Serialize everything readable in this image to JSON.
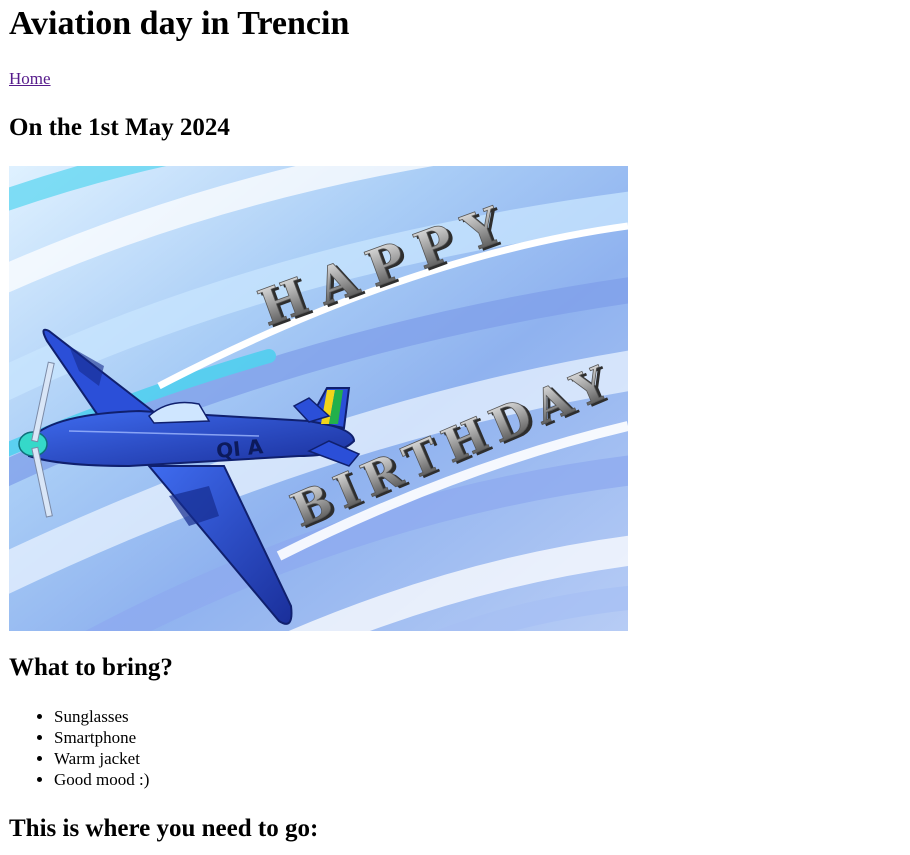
{
  "page_title": "Aviation day in Trencin",
  "nav": {
    "home_label": "Home"
  },
  "event_date": "On the 1st May 2024",
  "hero_image": {
    "line1": "HAPPY",
    "line2": "BIRTHDAY",
    "tail_code": "QI A",
    "colors": {
      "sky_light": "#eef6ff",
      "sky_mid": "#9fc4f5",
      "sky_deep": "#6f8fe6",
      "cyan": "#4fd6f0",
      "plane": "#2746c8",
      "plane_dark": "#14288a"
    }
  },
  "bring": {
    "heading": "What to bring?",
    "items": [
      "Sunglasses",
      "Smartphone",
      "Warm jacket",
      "Good mood :)"
    ]
  },
  "directions_heading": "This is where you need to go:"
}
